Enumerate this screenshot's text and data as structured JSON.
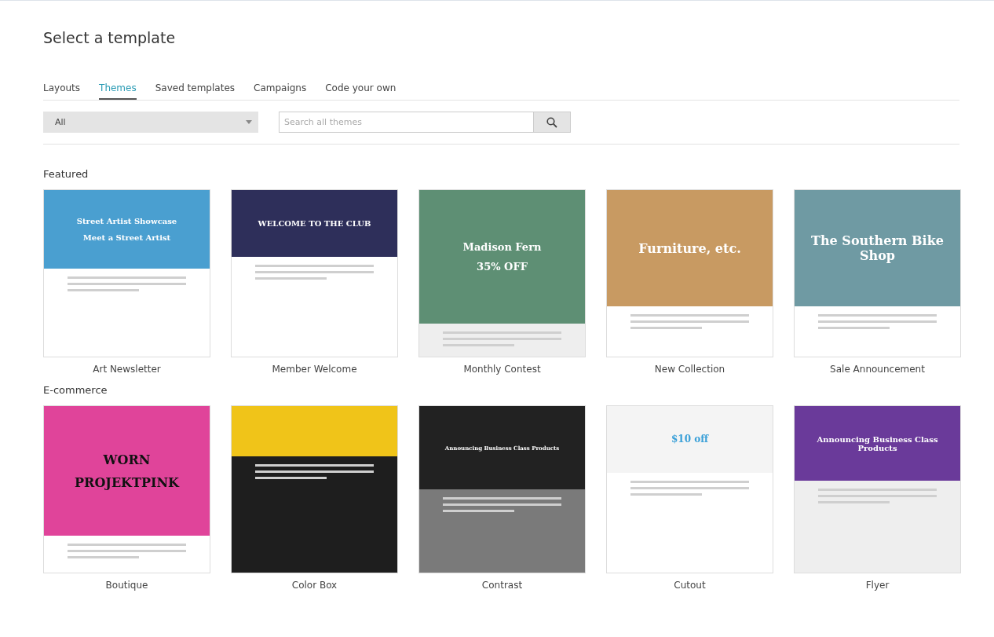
{
  "title": "Select a template",
  "tabs": [
    {
      "label": "Layouts",
      "selected": false
    },
    {
      "label": "Themes",
      "selected": true
    },
    {
      "label": "Saved templates",
      "selected": false
    },
    {
      "label": "Campaigns",
      "selected": false
    },
    {
      "label": "Code your own",
      "selected": false
    }
  ],
  "filter": {
    "value": "All"
  },
  "search": {
    "placeholder": "Search all themes"
  },
  "sections": [
    {
      "heading": "Featured",
      "templates": [
        {
          "name": "Art Newsletter",
          "preview": {
            "kind": "art",
            "texts": [
              "Street Artist Showcase",
              "Meet a Street Artist"
            ]
          }
        },
        {
          "name": "Member Welcome",
          "preview": {
            "kind": "welcome",
            "texts": [
              "WELCOME TO THE CLUB"
            ]
          }
        },
        {
          "name": "Monthly Contest",
          "preview": {
            "kind": "contest",
            "texts": [
              "Madison Fern",
              "35% OFF"
            ]
          }
        },
        {
          "name": "New Collection",
          "preview": {
            "kind": "collection",
            "texts": [
              "Furniture, etc."
            ]
          }
        },
        {
          "name": "Sale Announcement",
          "preview": {
            "kind": "bike",
            "texts": [
              "The Southern Bike Shop"
            ]
          }
        }
      ]
    },
    {
      "heading": "E-commerce",
      "templates": [
        {
          "name": "Boutique",
          "preview": {
            "kind": "boutique",
            "texts": [
              "WORN",
              "PROJEKTPINK"
            ]
          }
        },
        {
          "name": "Color Box",
          "preview": {
            "kind": "colorbox"
          }
        },
        {
          "name": "Contrast",
          "preview": {
            "kind": "contrast",
            "texts": [
              "Announcing Business Class Products"
            ]
          }
        },
        {
          "name": "Cutout",
          "preview": {
            "kind": "cutout",
            "texts": [
              "$10 off"
            ]
          }
        },
        {
          "name": "Flyer",
          "preview": {
            "kind": "flyer",
            "texts": [
              "Announcing Business Class Products"
            ]
          }
        }
      ]
    }
  ]
}
